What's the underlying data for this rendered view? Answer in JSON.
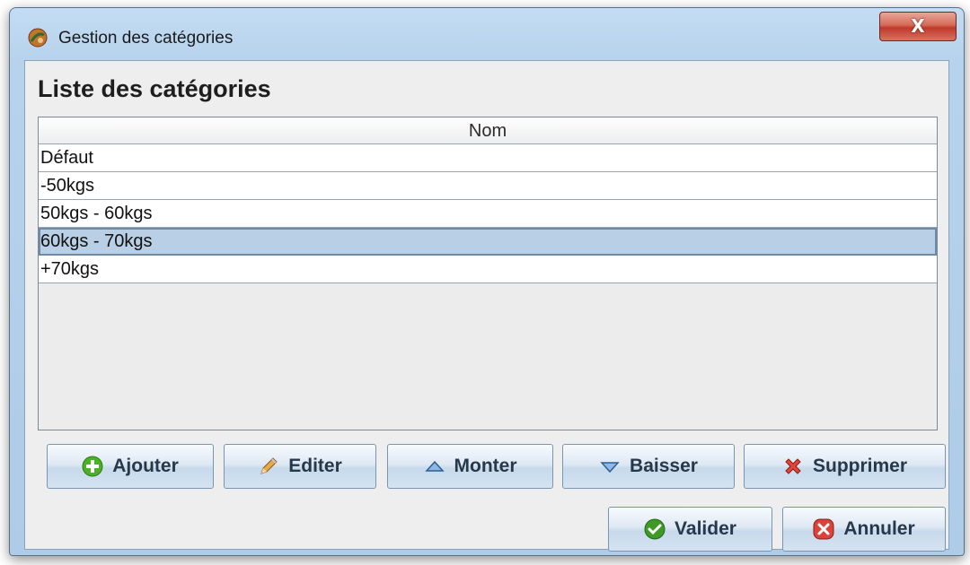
{
  "window": {
    "title": "Gestion des catégories",
    "close_label": "X"
  },
  "main": {
    "section_title": "Liste des catégories",
    "table": {
      "columns": [
        "Nom"
      ],
      "rows": [
        "Défaut",
        "-50kgs",
        "50kgs - 60kgs",
        "60kgs - 70kgs",
        "+70kgs"
      ],
      "selected_index": 3
    }
  },
  "toolbar": {
    "add_label": "Ajouter",
    "edit_label": "Editer",
    "up_label": "Monter",
    "down_label": "Baisser",
    "delete_label": "Supprimer"
  },
  "footer": {
    "ok_label": "Valider",
    "cancel_label": "Annuler"
  },
  "icons": {
    "app": "judo-app-icon",
    "add": "plus-circle-icon",
    "edit": "pencil-icon",
    "up": "triangle-up-icon",
    "down": "triangle-down-icon",
    "delete": "red-x-icon",
    "ok": "check-circle-icon",
    "cancel": "x-circle-icon"
  },
  "colors": {
    "selection": "#b9cfe6",
    "add_icon": "#4caf28",
    "delete_icon": "#e0453a",
    "ok_icon": "#3f9a25",
    "cancel_icon": "#d9433a"
  }
}
